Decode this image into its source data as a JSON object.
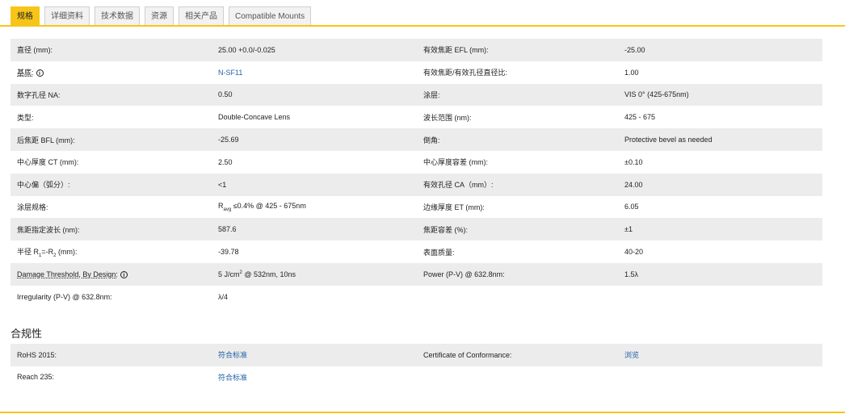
{
  "tabs": [
    "规格",
    "详细资料",
    "技术数据",
    "资源",
    "相关产品",
    "Compatible Mounts"
  ],
  "specs": {
    "r1": {
      "l1": "直径 (mm):",
      "v1": "25.00 +0.0/-0.025",
      "l2": "有效焦距 EFL (mm):",
      "v2": "-25.00"
    },
    "r2": {
      "l1": "基底:",
      "v1": "N-SF11",
      "l2": "有效焦距/有效孔径直径比:",
      "v2": "1.00"
    },
    "r3": {
      "l1": "数字孔径 NA:",
      "v1": "0.50",
      "l2": "涂层:",
      "v2": "VIS 0° (425-675nm)"
    },
    "r4": {
      "l1": "类型:",
      "v1": "Double-Concave Lens",
      "l2": "波长范围 (nm):",
      "v2": "425 - 675"
    },
    "r5": {
      "l1": "后焦距 BFL (mm):",
      "v1": "-25.69",
      "l2": "倒角:",
      "v2": "Protective bevel as needed"
    },
    "r6": {
      "l1": "中心厚度 CT (mm):",
      "v1": "2.50",
      "l2": "中心厚度容差 (mm):",
      "v2": "±0.10"
    },
    "r7": {
      "l1": "中心偏（弧分）:",
      "v1": "<1",
      "l2": "有效孔径 CA（mm）:",
      "v2": "24.00"
    },
    "r8": {
      "l1": "涂层规格:",
      "v1_R": "R",
      "v1_sub": "avg",
      "v1_rest": " ≤0.4% @ 425 - 675nm",
      "l2": "边缘厚度 ET (mm):",
      "v2": "6.05"
    },
    "r9": {
      "l1": "焦距指定波长 (nm):",
      "v1": "587.6",
      "l2": "焦距容差 (%):",
      "v2": "±1"
    },
    "r10": {
      "l1_a": "半径 R",
      "l1_s1": "1",
      "l1_b": "=-R",
      "l1_s2": "2",
      "l1_c": " (mm):",
      "v1": "-39.78",
      "l2": "表面质量:",
      "v2": "40-20"
    },
    "r11": {
      "l1": "Damage Threshold, By Design:",
      "v1_a": "5 J/cm",
      "v1_sup": "2",
      "v1_b": " @ 532nm, 10ns",
      "l2": "Power (P-V) @ 632.8nm:",
      "v2": "1.5λ"
    },
    "r12": {
      "l1": "Irregularity (P-V) @ 632.8nm:",
      "v1": "λ/4"
    }
  },
  "info_icon": "i",
  "compliance": {
    "title": "合规性",
    "r1": {
      "l1": "RoHS 2015:",
      "v1": "符合标准",
      "l2": "Certificate of Conformance:",
      "v2": "浏览"
    },
    "r2": {
      "l1": "Reach 235:",
      "v1": "符合标准"
    }
  }
}
